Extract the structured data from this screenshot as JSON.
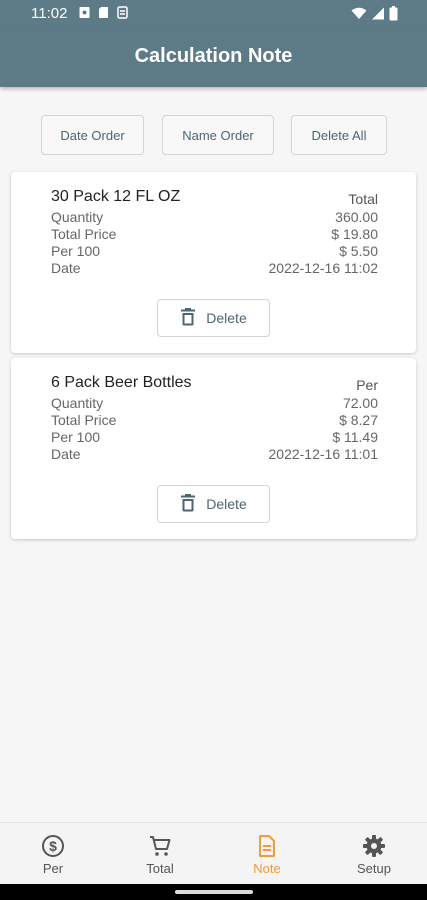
{
  "status": {
    "time": "11:02"
  },
  "appbar": {
    "title": "Calculation Note"
  },
  "buttons": {
    "date_order": "Date Order",
    "name_order": "Name Order",
    "delete_all": "Delete All"
  },
  "notes": [
    {
      "name": "30 Pack 12 FL OZ",
      "kind": "Total",
      "rows": [
        {
          "label": "Quantity",
          "value": "360.00"
        },
        {
          "label": "Total Price",
          "value": "$ 19.80"
        },
        {
          "label": "Per 100",
          "value": "$ 5.50"
        },
        {
          "label": "Date",
          "value": "2022-12-16 11:02"
        }
      ],
      "delete_label": "Delete"
    },
    {
      "name": "6 Pack Beer Bottles",
      "kind": "Per",
      "rows": [
        {
          "label": "Quantity",
          "value": "72.00"
        },
        {
          "label": "Total Price",
          "value": "$ 8.27"
        },
        {
          "label": "Per 100",
          "value": "$ 11.49"
        },
        {
          "label": "Date",
          "value": "2022-12-16 11:01"
        }
      ],
      "delete_label": "Delete"
    }
  ],
  "nav": [
    {
      "label": "Per",
      "icon": "dollar-circle-icon",
      "active": false
    },
    {
      "label": "Total",
      "icon": "cart-icon",
      "active": false
    },
    {
      "label": "Note",
      "icon": "note-icon",
      "active": true
    },
    {
      "label": "Setup",
      "icon": "gear-icon",
      "active": false
    }
  ],
  "colors": {
    "primary": "#5d7b87",
    "accent": "#f39a3a",
    "background": "#f6f6f6"
  }
}
